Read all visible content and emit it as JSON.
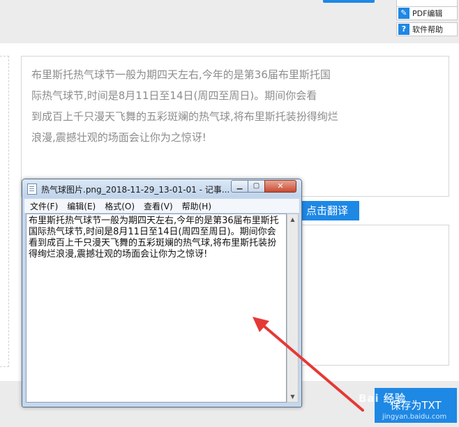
{
  "sidebar": {
    "pdf_edit_label": "PDF编辑",
    "help_label": "软件帮助"
  },
  "source": {
    "lines": [
      "布里斯托热气球节一般为期四天左右,今年的是第36届布里斯托国",
      "际热气球节,时间是8月11日至14日(周四至周日)。期间你会看",
      "到成百上千只漫天飞舞的五彩斑斓的热气球,将布里斯托装扮得绚烂",
      "浪漫,震撼壮观的场面会让你为之惊讶!"
    ]
  },
  "buttons": {
    "translate": "点击翻译",
    "save_txt": "保存为TXT"
  },
  "notepad": {
    "title": "热气球图片.png_2018-11-29_13-01-01 - 记事...",
    "menu": [
      "文件(F)",
      "编辑(E)",
      "格式(O)",
      "查看(V)",
      "帮助(H)"
    ],
    "content": "布里斯托热气球节一般为期四天左右,今年的是第36届布里斯托国际热气球节,时间是8月11日至14日(周四至周日)。期间你会看到成百上千只漫天飞舞的五彩斑斓的热气球,将布里斯托装扮得绚烂浪漫,震撼壮观的场面会让你为之惊讶!"
  },
  "watermark": {
    "text": "Bai 经验",
    "url": "jingyan.baidu.com"
  },
  "colors": {
    "accent": "#1e88e5",
    "arrow": "#e53935"
  }
}
